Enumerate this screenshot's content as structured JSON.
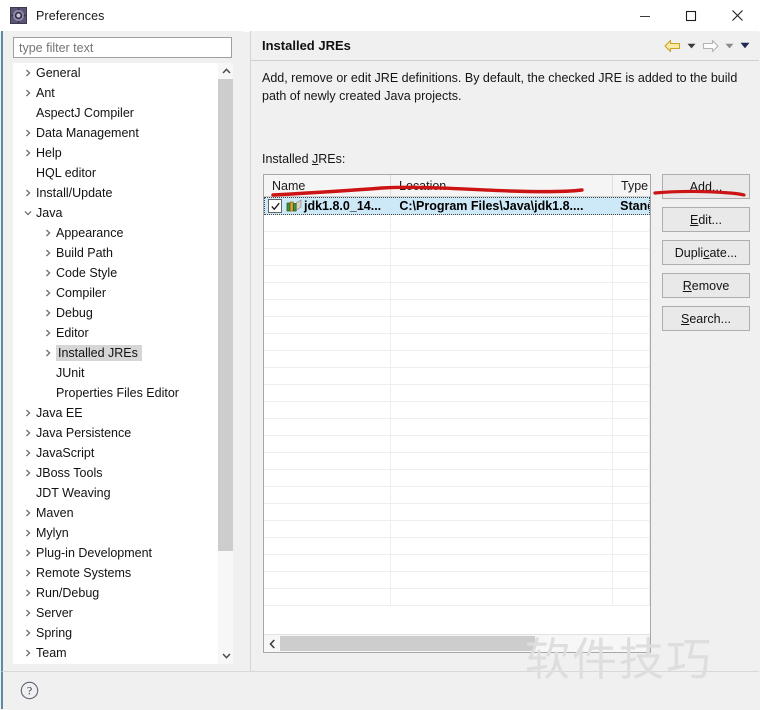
{
  "window": {
    "title": "Preferences",
    "icon": "preferences-gear-icon",
    "minimize_label": "Minimize",
    "maximize_label": "Maximize",
    "close_label": "Close"
  },
  "filter": {
    "value": "",
    "placeholder": "type filter text"
  },
  "tree": {
    "selected": "Installed JREs",
    "items": [
      {
        "label": "General",
        "depth": 0,
        "arrow": "collapsed"
      },
      {
        "label": "Ant",
        "depth": 0,
        "arrow": "collapsed"
      },
      {
        "label": "AspectJ Compiler",
        "depth": 0,
        "arrow": "none"
      },
      {
        "label": "Data Management",
        "depth": 0,
        "arrow": "collapsed"
      },
      {
        "label": "Help",
        "depth": 0,
        "arrow": "collapsed"
      },
      {
        "label": "HQL editor",
        "depth": 0,
        "arrow": "none"
      },
      {
        "label": "Install/Update",
        "depth": 0,
        "arrow": "collapsed"
      },
      {
        "label": "Java",
        "depth": 0,
        "arrow": "expanded"
      },
      {
        "label": "Appearance",
        "depth": 1,
        "arrow": "collapsed"
      },
      {
        "label": "Build Path",
        "depth": 1,
        "arrow": "collapsed"
      },
      {
        "label": "Code Style",
        "depth": 1,
        "arrow": "collapsed"
      },
      {
        "label": "Compiler",
        "depth": 1,
        "arrow": "collapsed"
      },
      {
        "label": "Debug",
        "depth": 1,
        "arrow": "collapsed"
      },
      {
        "label": "Editor",
        "depth": 1,
        "arrow": "collapsed"
      },
      {
        "label": "Installed JREs",
        "depth": 1,
        "arrow": "collapsed",
        "selected": true
      },
      {
        "label": "JUnit",
        "depth": 1,
        "arrow": "none"
      },
      {
        "label": "Properties Files Editor",
        "depth": 1,
        "arrow": "none"
      },
      {
        "label": "Java EE",
        "depth": 0,
        "arrow": "collapsed"
      },
      {
        "label": "Java Persistence",
        "depth": 0,
        "arrow": "collapsed"
      },
      {
        "label": "JavaScript",
        "depth": 0,
        "arrow": "collapsed"
      },
      {
        "label": "JBoss Tools",
        "depth": 0,
        "arrow": "collapsed"
      },
      {
        "label": "JDT Weaving",
        "depth": 0,
        "arrow": "none"
      },
      {
        "label": "Maven",
        "depth": 0,
        "arrow": "collapsed"
      },
      {
        "label": "Mylyn",
        "depth": 0,
        "arrow": "collapsed"
      },
      {
        "label": "Plug-in Development",
        "depth": 0,
        "arrow": "collapsed"
      },
      {
        "label": "Remote Systems",
        "depth": 0,
        "arrow": "collapsed"
      },
      {
        "label": "Run/Debug",
        "depth": 0,
        "arrow": "collapsed"
      },
      {
        "label": "Server",
        "depth": 0,
        "arrow": "collapsed"
      },
      {
        "label": "Spring",
        "depth": 0,
        "arrow": "collapsed"
      },
      {
        "label": "Team",
        "depth": 0,
        "arrow": "collapsed"
      }
    ]
  },
  "page": {
    "title": "Installed JREs",
    "description": "Add, remove or edit JRE definitions. By default, the checked JRE is added to the build path of newly created Java projects.",
    "list_label_prefix": "Installed ",
    "list_label_mnemonic": "J",
    "list_label_suffix": "REs:",
    "nav": {
      "back_icon": "back-arrow-icon",
      "back_dropdown_icon": "chevron-down-icon",
      "forward_icon": "forward-arrow-icon",
      "forward_dropdown_icon": "chevron-down-icon",
      "menu_icon": "chevron-down-icon"
    }
  },
  "table": {
    "columns": [
      "Name",
      "Location",
      "Type"
    ],
    "rows": [
      {
        "checked": true,
        "icon": "jre-library-icon",
        "name": "jdk1.8.0_14...",
        "location": "C:\\Program Files\\Java\\jdk1.8....",
        "type": "Standar",
        "selected": true
      }
    ],
    "empty_row_count": 23,
    "hscroll": {
      "left_icon": "chevron-left-icon"
    }
  },
  "buttons": [
    {
      "prefix": "",
      "mnemonic": "A",
      "suffix": "dd...",
      "name": "add-button"
    },
    {
      "prefix": "",
      "mnemonic": "E",
      "suffix": "dit...",
      "name": "edit-button"
    },
    {
      "prefix": "Dupli",
      "mnemonic": "c",
      "suffix": "ate...",
      "name": "duplicate-button"
    },
    {
      "prefix": "",
      "mnemonic": "R",
      "suffix": "emove",
      "name": "remove-button"
    },
    {
      "prefix": "",
      "mnemonic": "S",
      "suffix": "earch...",
      "name": "search-button"
    }
  ],
  "bottom": {
    "help_icon": "help-question-icon"
  },
  "annotations": {
    "color": "#cc1414",
    "marks": [
      "underline-under-jre-row",
      "underline-under-edit-button"
    ]
  },
  "watermark": {
    "text": "软件技巧",
    "color": "#dedede"
  }
}
